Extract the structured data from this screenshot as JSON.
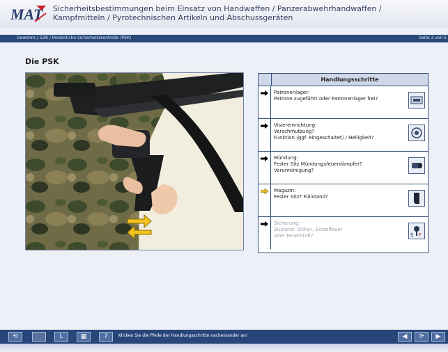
{
  "header": {
    "logo_text": "MAT",
    "title_line1": "Sicherheitsbestimmungen beim Einsatz von Handwaffen / Panzerabwehrhandwaffen /",
    "title_line2": "Kampfmitteln / Pyrotechnischen Artikeln und Abschussgeräten"
  },
  "breadcrumb": "Gewehre / G36 / Persönliche Sicherheitskontrolle (PSK)",
  "page_indicator": "Seite 3 von 5",
  "page_title": "Die PSK",
  "panel": {
    "heading": "Handlungsschritte",
    "rows": [
      {
        "text": "Patronenlager:\nPatrone zugeführt oder Patronenlager frei?",
        "arrow": "black",
        "icon": "chamber-icon"
      },
      {
        "text": "Visiereinrichtung:\nVerschmutzung?\nFunktion (ggf. eingeschaltet) / Helligkeit?",
        "arrow": "black",
        "icon": "sight-icon"
      },
      {
        "text": "Mündung:\nFester Sitz Mündungsfeuerdämpfer?\nVerunreinigung?",
        "arrow": "black",
        "icon": "muzzle-icon"
      },
      {
        "text": "Magazin:\nFester Sitz? Füllstand?",
        "arrow": "yellow",
        "icon": "magazine-icon"
      },
      {
        "text": "Sicherung:\nZustand: Sicher, Einzelfeuer\noder Feuerstoß?",
        "arrow": "black",
        "icon": "safety-selector-icon",
        "dim": true
      }
    ]
  },
  "footer": {
    "instruction": "Klicken Sie die Pfeile der Handlungsschritte nacheinander an!",
    "help_label": "?",
    "glossary_label": "L"
  },
  "colors": {
    "header_bar": "#28497a",
    "footer_bar": "#27467a",
    "panel_border": "#34507e",
    "panel_head": "#cfd8e8",
    "active_arrow": "#e8c02a",
    "logo_red": "#c81e2a"
  }
}
